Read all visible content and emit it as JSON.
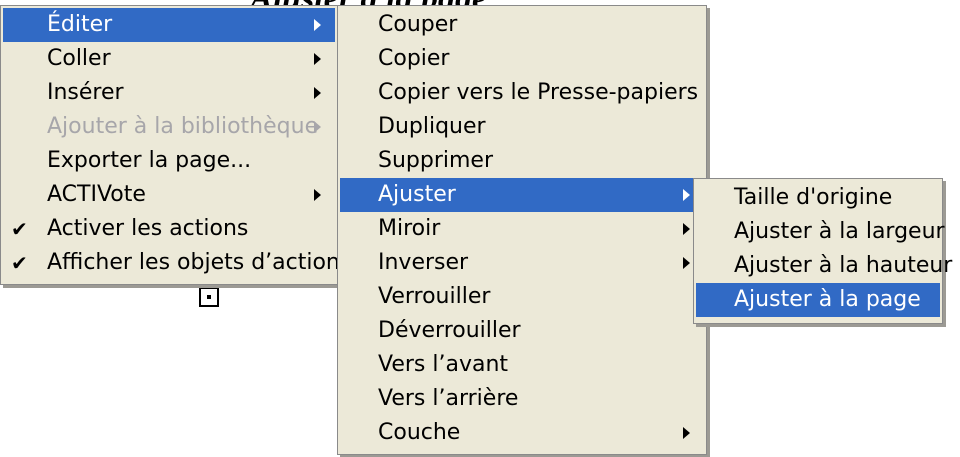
{
  "header": {
    "title": "Ajuster à la page"
  },
  "menu_main": {
    "items": [
      {
        "label": "Éditer",
        "submenu": true,
        "state": "highlighted"
      },
      {
        "label": "Coller",
        "submenu": true
      },
      {
        "label": "Insérer",
        "submenu": true
      },
      {
        "label": "Ajouter à la bibliothèque",
        "submenu": true,
        "state": "disabled"
      },
      {
        "label": "Exporter la page..."
      },
      {
        "label": "ACTIVote",
        "submenu": true
      },
      {
        "label": "Activer les actions",
        "checked": true
      },
      {
        "label": "Afficher les objets d’action",
        "checked": true
      }
    ]
  },
  "menu_edit": {
    "items": [
      {
        "label": "Couper"
      },
      {
        "label": "Copier"
      },
      {
        "label": "Copier vers le Presse-papiers"
      },
      {
        "label": "Dupliquer"
      },
      {
        "label": "Supprimer"
      },
      {
        "label": "Ajuster",
        "submenu": true,
        "state": "highlighted"
      },
      {
        "label": "Miroir",
        "submenu": true
      },
      {
        "label": "Inverser",
        "submenu": true
      },
      {
        "label": "Verrouiller"
      },
      {
        "label": "Déverrouiller"
      },
      {
        "label": "Vers l’avant"
      },
      {
        "label": "Vers l’arrière"
      },
      {
        "label": "Couche",
        "submenu": true
      }
    ]
  },
  "menu_fit": {
    "items": [
      {
        "label": "Taille d'origine"
      },
      {
        "label": "Ajuster à la largeur"
      },
      {
        "label": "Ajuster à la hauteur"
      },
      {
        "label": "Ajuster à la page",
        "state": "highlighted"
      }
    ]
  },
  "colors": {
    "menu_bg": "#ece9d8",
    "highlight": "#316ac5",
    "disabled_text": "#a7a6aa"
  },
  "icons": {
    "checkmark": "checkmark-icon",
    "submenu": "submenu-arrow-icon",
    "handle": "selection-handle-icon"
  }
}
